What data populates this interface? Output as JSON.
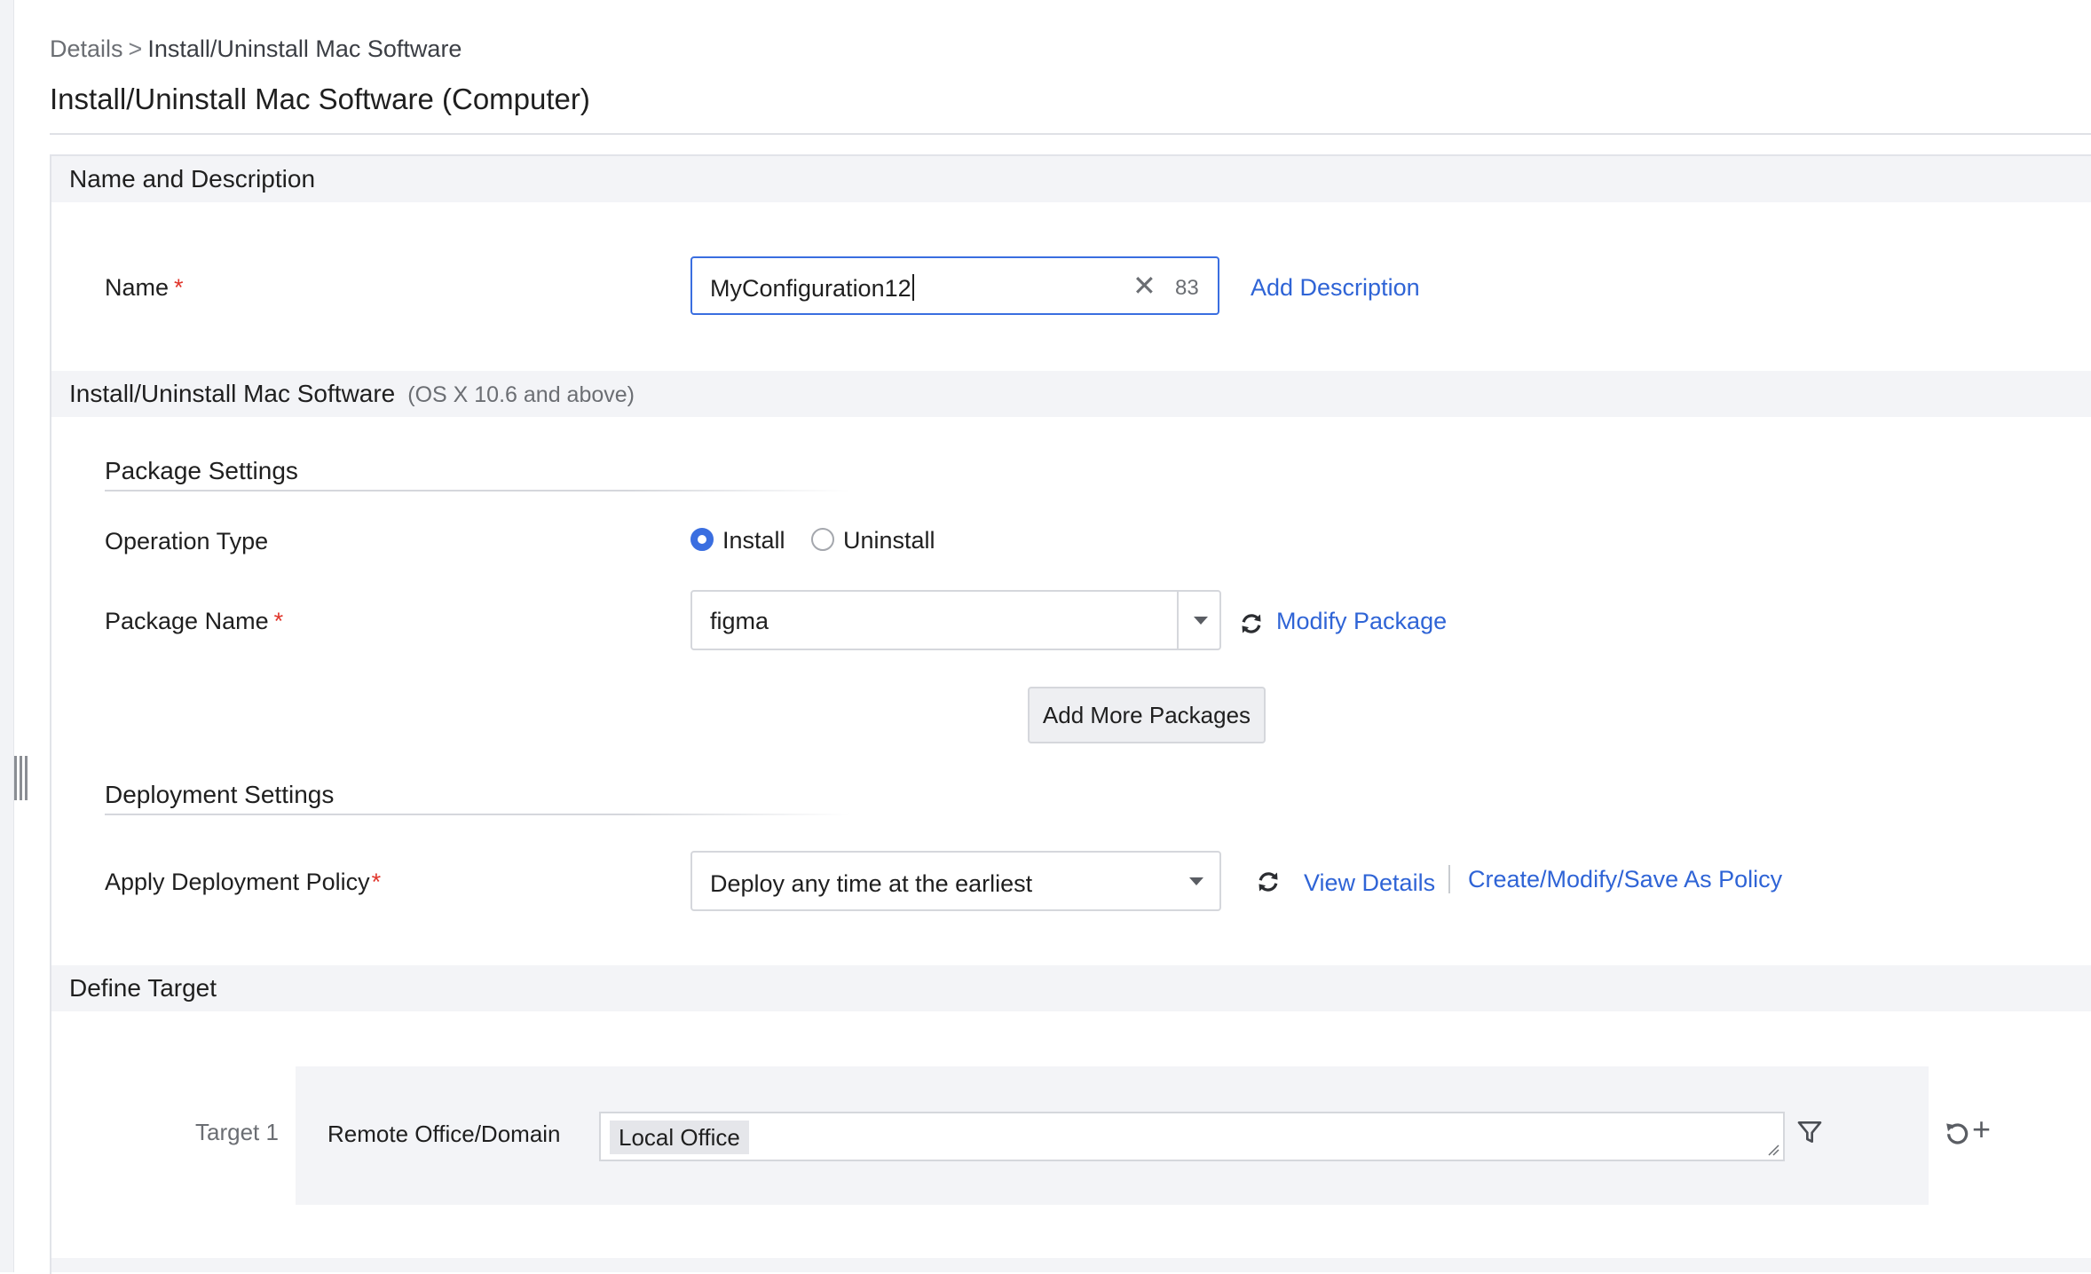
{
  "breadcrumb": {
    "parent": "Details",
    "separator": ">",
    "current": "Install/Uninstall Mac Software"
  },
  "page": {
    "title": "Install/Uninstall Mac Software (Computer)"
  },
  "sections": {
    "name_description": {
      "title": "Name and Description"
    },
    "mac_software": {
      "title": "Install/Uninstall Mac Software",
      "subtitle": "(OS X 10.6 and above)"
    },
    "define_target": {
      "title": "Define Target"
    }
  },
  "name_field": {
    "label": "Name",
    "required_mark": "*",
    "value": "MyConfiguration12",
    "clear_glyph": "✕",
    "char_count": "83",
    "add_description_link": "Add Description"
  },
  "package_settings": {
    "title": "Package Settings",
    "operation_type": {
      "label": "Operation Type",
      "options": [
        {
          "label": "Install",
          "selected": true
        },
        {
          "label": "Uninstall",
          "selected": false
        }
      ]
    },
    "package_name": {
      "label": "Package Name",
      "required_mark": "*",
      "value": "figma",
      "modify_link": "Modify Package"
    },
    "add_more_button": "Add More Packages"
  },
  "deployment_settings": {
    "title": "Deployment Settings",
    "policy": {
      "label": "Apply Deployment Policy",
      "required_mark": "*",
      "value": "Deploy any time at the earliest",
      "view_details_link": "View Details",
      "create_modify_link": "Create/Modify/Save As Policy"
    }
  },
  "target": {
    "label": "Target 1",
    "field_label": "Remote Office/Domain",
    "chips": [
      "Local Office"
    ]
  },
  "icons": {
    "refresh": "refresh-icon",
    "filter": "filter-icon",
    "reset": "reset-icon",
    "add": "+",
    "collapse": "collapse-handle-icon"
  },
  "colors": {
    "accent": "#3a6ee0",
    "link": "#2f64d6",
    "required": "#e0352b",
    "section_bg": "#f3f4f7"
  }
}
